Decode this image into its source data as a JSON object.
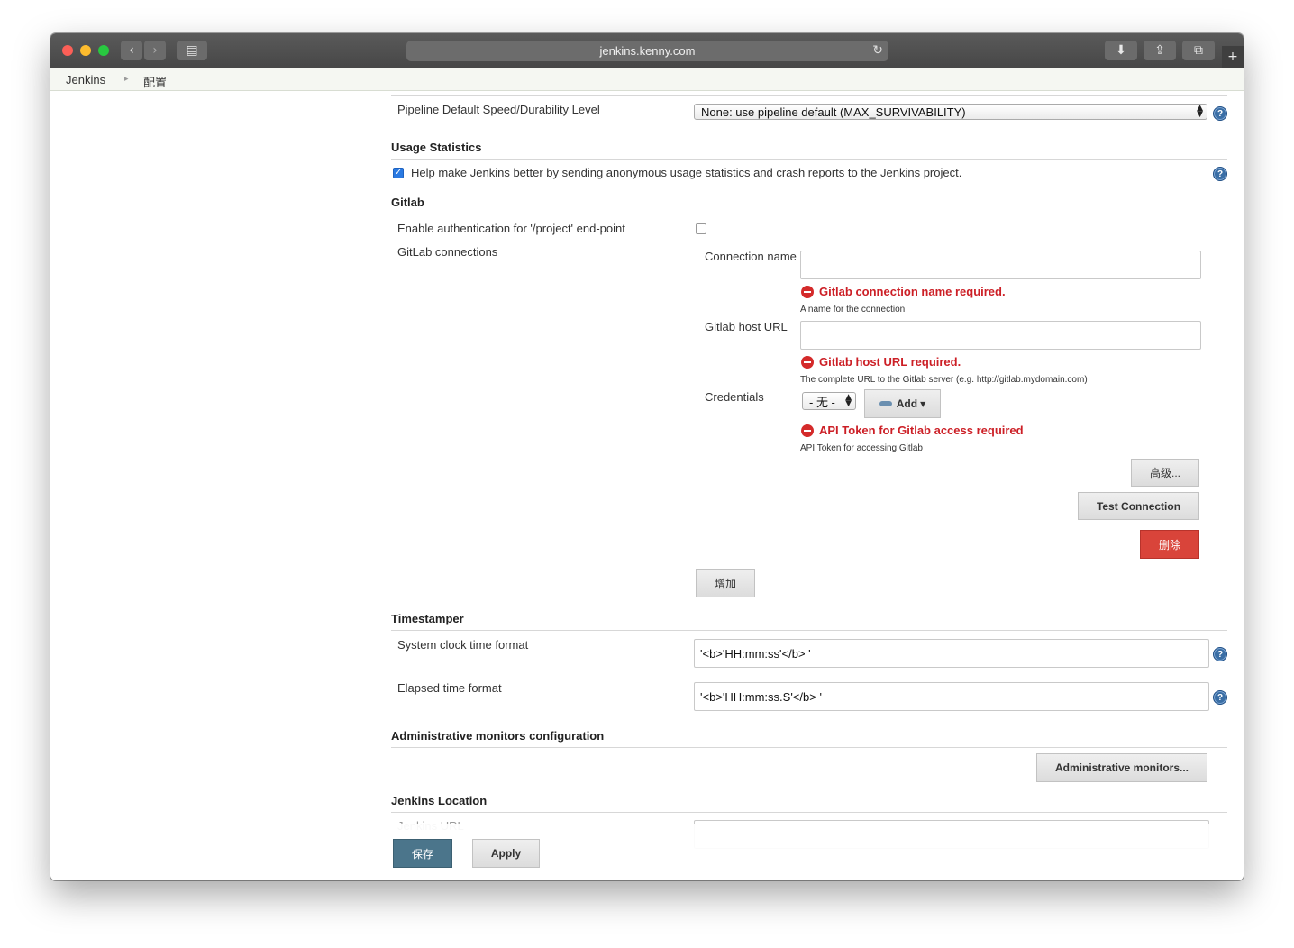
{
  "browser": {
    "url": "jenkins.kenny.com",
    "back_icon": "‹",
    "forward_icon": "›",
    "reload_icon": "↻",
    "download_icon": "⬇",
    "share_icon": "⇪",
    "tabs_icon": "⧉",
    "new_tab_icon": "+",
    "sidebar_icon": "▤"
  },
  "breadcrumb": {
    "items": [
      "Jenkins",
      "配置"
    ],
    "separator": "▸"
  },
  "pipeline": {
    "label": "Pipeline Default Speed/Durability Level",
    "selected": "None: use pipeline default (MAX_SURVIVABILITY)"
  },
  "usage_statistics": {
    "heading": "Usage Statistics",
    "checkbox_label": "Help make Jenkins better by sending anonymous usage statistics and crash reports to the Jenkins project.",
    "checked": true
  },
  "gitlab": {
    "heading": "Gitlab",
    "auth_label": "Enable authentication for '/project' end-point",
    "auth_checked": false,
    "connections_label": "GitLab connections",
    "connection_name_label": "Connection name",
    "connection_name_value": "",
    "connection_name_error": "Gitlab connection name required.",
    "connection_name_hint": "A name for the connection",
    "host_url_label": "Gitlab host URL",
    "host_url_value": "",
    "host_url_error": "Gitlab host URL required.",
    "host_url_hint": "The complete URL to the Gitlab server (e.g. http://gitlab.mydomain.com)",
    "credentials_label": "Credentials",
    "credentials_selected": "- 无 -",
    "add_label": "Add",
    "credentials_error": "API Token for Gitlab access required",
    "credentials_hint": "API Token for accessing Gitlab",
    "advanced_button": "高级...",
    "test_connection_button": "Test Connection",
    "delete_button": "删除",
    "add_button": "增加"
  },
  "timestamper": {
    "heading": "Timestamper",
    "system_clock_label": "System clock time format",
    "system_clock_value": "'<b>'HH:mm:ss'</b> '",
    "elapsed_label": "Elapsed time format",
    "elapsed_value": "'<b>'HH:mm:ss.S'</b> '"
  },
  "admin_monitors": {
    "heading": "Administrative monitors configuration",
    "button": "Administrative monitors..."
  },
  "jenkins_location": {
    "heading": "Jenkins Location",
    "url_label": "Jenkins URL"
  },
  "footer": {
    "save_button": "保存",
    "apply_button": "Apply"
  },
  "help_icon": "?"
}
